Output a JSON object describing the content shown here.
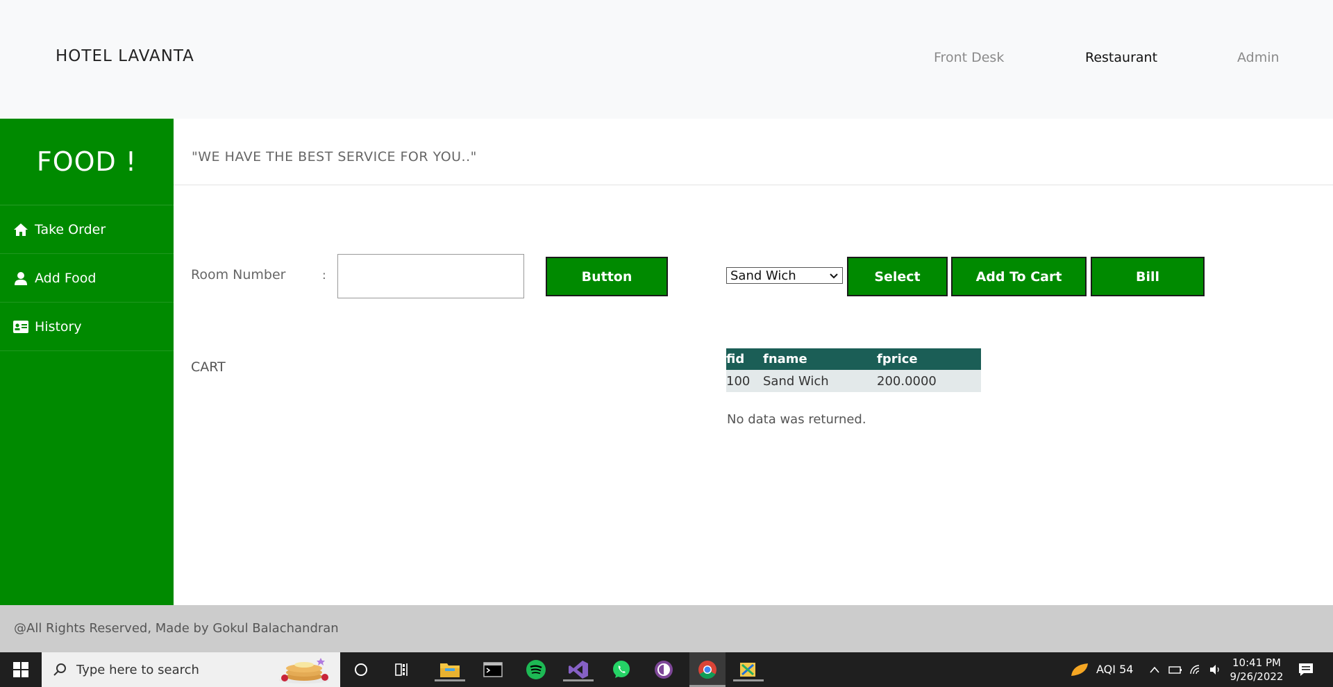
{
  "navbar": {
    "brand": "HOTEL LAVANTA",
    "links": [
      {
        "label": "Front Desk"
      },
      {
        "label": "Restaurant"
      },
      {
        "label": "Admin"
      }
    ]
  },
  "sidebar": {
    "title": "FOOD !",
    "items": [
      {
        "label": "Take Order",
        "icon": "home-icon"
      },
      {
        "label": "Add Food",
        "icon": "user-icon"
      },
      {
        "label": "History",
        "icon": "id-card-icon"
      }
    ]
  },
  "main": {
    "tagline": "\"WE HAVE THE BEST SERVICE FOR YOU..\"",
    "room_label": "Room Number",
    "colon": ":",
    "room_input_value": "",
    "button_label": "Button",
    "food_select_value": "Sand Wich",
    "select_label": "Select",
    "add_to_cart_label": "Add To Cart",
    "bill_label": "Bill",
    "cart_label": "CART",
    "table": {
      "headers": [
        "fid",
        "fname",
        "fprice"
      ],
      "rows": [
        [
          "100",
          "Sand Wich",
          "200.0000"
        ]
      ]
    },
    "no_data": "No data was returned."
  },
  "footer": {
    "text": "@All Rights Reserved, Made by Gokul Balachandran"
  },
  "taskbar": {
    "search_placeholder": "Type here to search",
    "aqi": "AQI 54",
    "time": "10:41 PM",
    "date": "9/26/2022"
  },
  "colors": {
    "sidebar_green": "#008a00",
    "table_header": "#1b5e56",
    "footer_gray": "#cccccc",
    "navbar_bg": "#f8f9fa"
  }
}
